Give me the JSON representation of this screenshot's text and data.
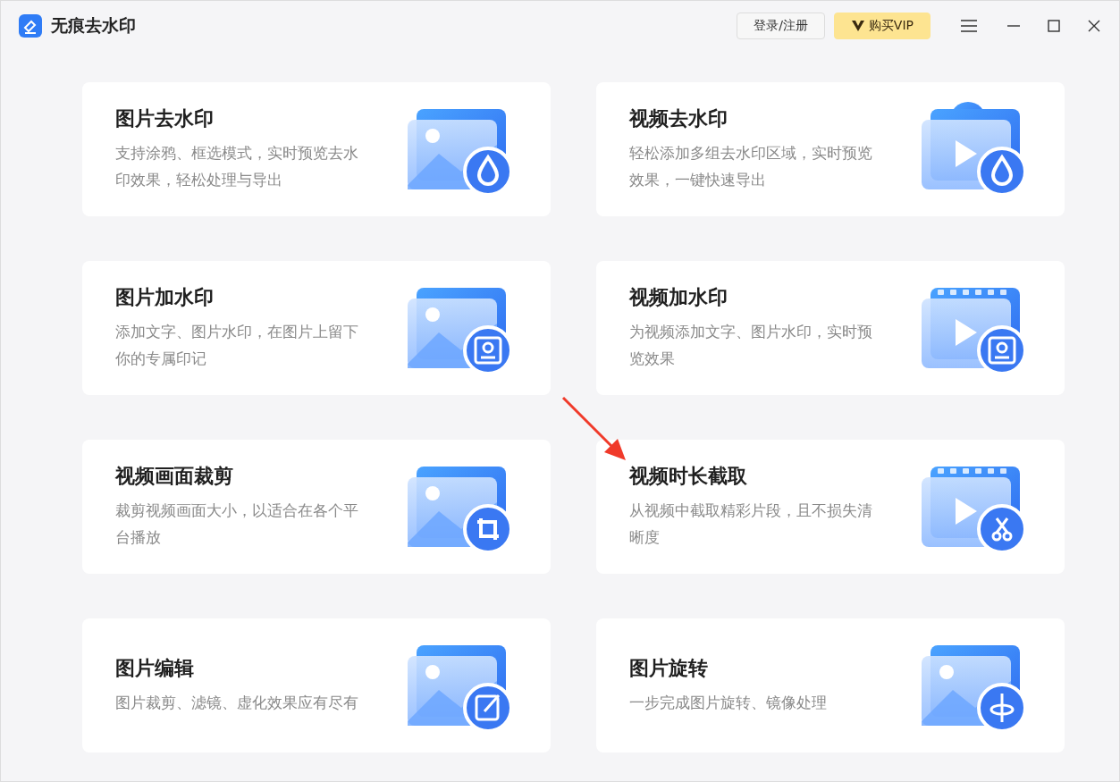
{
  "window": {
    "title": "无痕去水印"
  },
  "header_buttons": [
    {
      "label": "登录/注册",
      "kind": "plain"
    },
    {
      "label": "购买VIP",
      "kind": "vip"
    }
  ],
  "cards": [
    {
      "title": "图片去水印",
      "description": "支持涂鸦、框选模式，实时预览去水印效果，轻松处理与导出"
    },
    {
      "title": "视频去水印",
      "description": "轻松添加多组去水印区域，实时预览效果，一键快速导出"
    },
    {
      "title": "图片加水印",
      "description": "添加文字、图片水印，在图片上留下你的专属印记"
    },
    {
      "title": "视频加水印",
      "description": "为视频添加文字、图片水印，实时预览效果"
    },
    {
      "title": "视频画面裁剪",
      "description": "裁剪视频画面大小，以适合在各个平台播放"
    },
    {
      "title": "视频时长截取",
      "description": "从视频中截取精彩片段，且不损失清晰度"
    },
    {
      "title": "图片编辑",
      "description": "图片裁剪、滤镜、虚化效果应有尽有"
    },
    {
      "title": "图片旋转",
      "description": "一步完成图片旋转、镜像处理"
    }
  ]
}
